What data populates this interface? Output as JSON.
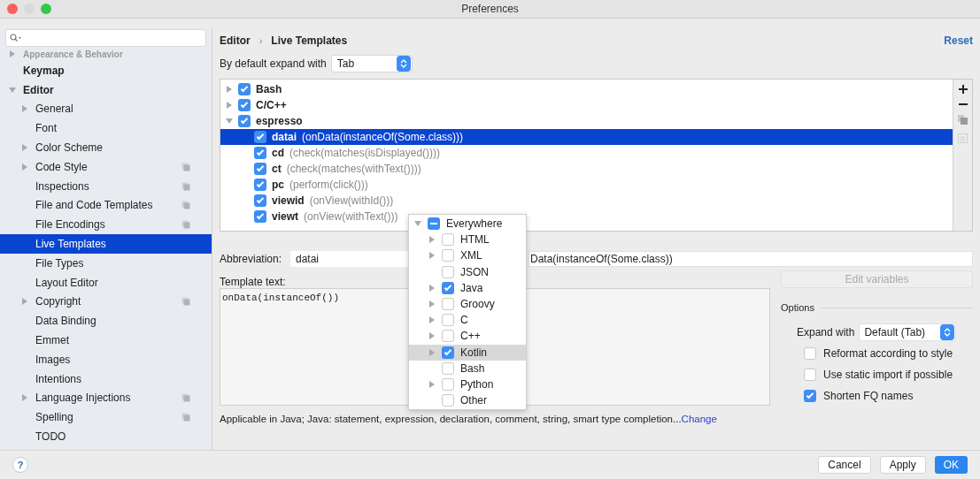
{
  "window": {
    "title": "Preferences"
  },
  "sidebar": {
    "items": [
      {
        "label": "Appearance & Behavior",
        "expanded": false,
        "selected": false,
        "copy_icon": false
      },
      {
        "label": "Keymap",
        "selected": false,
        "copy_icon": false
      },
      {
        "label": "Editor",
        "expanded": true,
        "selected": false,
        "copy_icon": false,
        "children": [
          {
            "label": "General",
            "expanded": false,
            "selected": false,
            "copy_icon": false
          },
          {
            "label": "Font",
            "selected": false,
            "copy_icon": false
          },
          {
            "label": "Color Scheme",
            "expanded": false,
            "selected": false,
            "copy_icon": false
          },
          {
            "label": "Code Style",
            "expanded": false,
            "selected": false,
            "copy_icon": true
          },
          {
            "label": "Inspections",
            "selected": false,
            "copy_icon": true
          },
          {
            "label": "File and Code Templates",
            "selected": false,
            "copy_icon": true
          },
          {
            "label": "File Encodings",
            "selected": false,
            "copy_icon": true
          },
          {
            "label": "Live Templates",
            "selected": true,
            "copy_icon": false
          },
          {
            "label": "File Types",
            "selected": false,
            "copy_icon": false
          },
          {
            "label": "Layout Editor",
            "selected": false,
            "copy_icon": false
          },
          {
            "label": "Copyright",
            "expanded": false,
            "selected": false,
            "copy_icon": true
          },
          {
            "label": "Data Binding",
            "selected": false,
            "copy_icon": false
          },
          {
            "label": "Emmet",
            "selected": false,
            "copy_icon": false
          },
          {
            "label": "Images",
            "selected": false,
            "copy_icon": false
          },
          {
            "label": "Intentions",
            "selected": false,
            "copy_icon": false
          },
          {
            "label": "Language Injections",
            "expanded": false,
            "selected": false,
            "copy_icon": true
          },
          {
            "label": "Spelling",
            "selected": false,
            "copy_icon": true
          },
          {
            "label": "TODO",
            "selected": false,
            "copy_icon": false
          }
        ]
      }
    ]
  },
  "breadcrumb": [
    "Editor",
    "›",
    "Live Templates"
  ],
  "reset": "Reset",
  "expand_default": {
    "label": "By default expand with",
    "value": "Tab"
  },
  "templates": [
    {
      "name": "Bash",
      "expanded": false,
      "checked": true
    },
    {
      "name": "C/C++",
      "expanded": false,
      "checked": true
    },
    {
      "name": "espresso",
      "expanded": true,
      "checked": true,
      "children": [
        {
          "abbreviation": "datai",
          "description": "(onData(instanceOf(Some.class)))",
          "checked": true,
          "selected": true
        },
        {
          "abbreviation": "cd",
          "description": "(check(matches(isDisplayed())))",
          "checked": true,
          "selected": false
        },
        {
          "abbreviation": "ct",
          "description": "(check(matches(withText())))",
          "checked": true,
          "selected": false
        },
        {
          "abbreviation": "pc",
          "description": "(perform(click()))",
          "checked": true,
          "selected": false
        },
        {
          "abbreviation": "viewid",
          "description": "(onView(withId()))",
          "checked": true,
          "selected": false
        },
        {
          "abbreviation": "viewt",
          "description": "(onView(withText()))",
          "checked": true,
          "selected": false
        }
      ]
    }
  ],
  "abbreviation": {
    "label": "Abbreviation:",
    "value": "datai"
  },
  "description": {
    "value": "Data(instanceOf(Some.class))"
  },
  "template_text": {
    "label": "Template text:",
    "value": "onData(instanceOf())"
  },
  "edit_variables": {
    "label": "Edit variables",
    "disabled": true
  },
  "options": {
    "title": "Options",
    "expand_with": {
      "label": "Expand with",
      "value": "Default (Tab)"
    },
    "checkboxes": [
      {
        "label": "Reformat according to style",
        "checked": false
      },
      {
        "label": "Use static import if possible",
        "checked": false
      },
      {
        "label": "Shorten FQ names",
        "checked": true
      }
    ]
  },
  "applicable": {
    "text": "Applicable in Java; Java: statement, expression, declaration, comment, string, smart type completion...",
    "link": "Change"
  },
  "context_popup": {
    "items": [
      {
        "label": "Everywhere",
        "expanded": true,
        "indeterminate": true,
        "selected": false,
        "children": [
          {
            "label": "HTML",
            "expanded": false,
            "checked": false,
            "selected": false
          },
          {
            "label": "XML",
            "expanded": false,
            "checked": false,
            "selected": false
          },
          {
            "label": "JSON",
            "checked": false,
            "selected": false
          },
          {
            "label": "Java",
            "expanded": false,
            "checked": true,
            "selected": false
          },
          {
            "label": "Groovy",
            "expanded": false,
            "checked": false,
            "selected": false
          },
          {
            "label": "C",
            "expanded": false,
            "checked": false,
            "selected": false
          },
          {
            "label": "C++",
            "expanded": false,
            "checked": false,
            "selected": false
          },
          {
            "label": "Kotlin",
            "expanded": false,
            "checked": true,
            "selected": true
          },
          {
            "label": "Bash",
            "checked": false,
            "selected": false
          },
          {
            "label": "Python",
            "expanded": false,
            "checked": false,
            "selected": false
          },
          {
            "label": "Other",
            "checked": false,
            "selected": false
          }
        ]
      }
    ]
  },
  "footer": {
    "help": "?",
    "buttons": [
      {
        "label": "Cancel",
        "kind": "default"
      },
      {
        "label": "Apply",
        "kind": "default"
      },
      {
        "label": "OK",
        "kind": "primary"
      }
    ]
  }
}
